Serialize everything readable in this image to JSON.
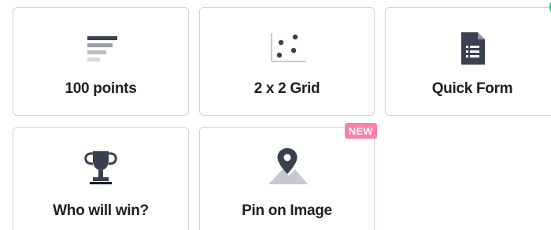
{
  "cards": [
    {
      "label": "100 points",
      "icon": "bar-list-icon"
    },
    {
      "label": "2 x 2 Grid",
      "icon": "scatter-grid-icon"
    },
    {
      "label": "Quick Form",
      "icon": "form-document-icon"
    },
    {
      "label": "Who will win?",
      "icon": "trophy-icon"
    },
    {
      "label": "Pin on Image",
      "icon": "pin-on-image-icon",
      "badge": "NEW"
    }
  ],
  "colors": {
    "icon_dark": "#3b4050",
    "icon_light": "#c6c9d1",
    "badge_bg": "#ff7fa6",
    "corner_indicator": "#1fc37a",
    "border": "#cfd3db"
  }
}
